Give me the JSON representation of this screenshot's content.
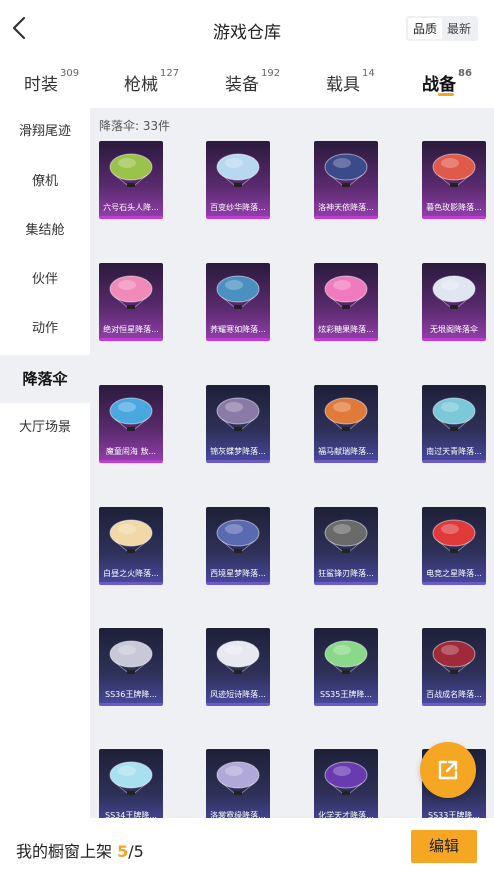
{
  "header": {
    "title": "游戏仓库",
    "sort_options": [
      "品质",
      "最新"
    ],
    "sort_selected": "品质"
  },
  "tabs": [
    {
      "label": "时装",
      "count": "309",
      "active": false
    },
    {
      "label": "枪械",
      "count": "127",
      "active": false
    },
    {
      "label": "装备",
      "count": "192",
      "active": false
    },
    {
      "label": "载具",
      "count": "14",
      "active": false
    },
    {
      "label": "战备",
      "count": "86",
      "active": true
    }
  ],
  "sidebar": {
    "items": [
      {
        "label": "滑翔尾迹",
        "active": false
      },
      {
        "label": "僚机",
        "active": false
      },
      {
        "label": "集结舱",
        "active": false
      },
      {
        "label": "伙伴",
        "active": false
      },
      {
        "label": "动作",
        "active": false
      },
      {
        "label": "降落伞",
        "active": true
      },
      {
        "label": "大厅场景",
        "active": false
      }
    ]
  },
  "content": {
    "count_label": "降落伞: 33件",
    "items": [
      {
        "name": "六号石头人降...",
        "rarity": "purple",
        "color": "#9bc24a"
      },
      {
        "name": "百变纱华降落...",
        "rarity": "purple",
        "color": "#b8d8f0"
      },
      {
        "name": "洛神天依降落...",
        "rarity": "purple",
        "color": "#3b4a8a"
      },
      {
        "name": "暮色玫影降落...",
        "rarity": "purple",
        "color": "#e05a4a"
      },
      {
        "name": "绝对恒星降落...",
        "rarity": "purple",
        "color": "#f08ab8"
      },
      {
        "name": "荞耀寒如降落...",
        "rarity": "purple",
        "color": "#4a90c0"
      },
      {
        "name": "炫彩糖果降落...",
        "rarity": "purple",
        "color": "#f07ac0"
      },
      {
        "name": "无垠阁降落伞",
        "rarity": "purple",
        "color": "#dfe6f2"
      },
      {
        "name": "魔童闹海 敖...",
        "rarity": "purple",
        "color": "#4aa8e0"
      },
      {
        "name": "锦灰蝶梦降落...",
        "rarity": "blue",
        "color": "#8a7aa8"
      },
      {
        "name": "福马献瑞降落...",
        "rarity": "blue",
        "color": "#e07a3a"
      },
      {
        "name": "南过天青降落...",
        "rarity": "blue",
        "color": "#7ac8d8"
      },
      {
        "name": "白昼之火降落...",
        "rarity": "blue",
        "color": "#f0d8a8"
      },
      {
        "name": "西境星梦降落...",
        "rarity": "blue",
        "color": "#5a6ab0"
      },
      {
        "name": "狂鲨锋刃降落...",
        "rarity": "blue",
        "color": "#6a6a6a"
      },
      {
        "name": "电竞之星降落...",
        "rarity": "blue",
        "color": "#e03a3a"
      },
      {
        "name": "SS36王牌降...",
        "rarity": "blue",
        "color": "#c8c8d8"
      },
      {
        "name": "风迹短诗降落...",
        "rarity": "blue",
        "color": "#e8e8f0"
      },
      {
        "name": "SS35王牌降...",
        "rarity": "blue",
        "color": "#8ad88a"
      },
      {
        "name": "百战成名降落...",
        "rarity": "blue",
        "color": "#a02a3a"
      },
      {
        "name": "SS34王牌降...",
        "rarity": "blue",
        "color": "#a8e0f0"
      },
      {
        "name": "洛裳霓缘降落...",
        "rarity": "blue",
        "color": "#b0a8d8"
      },
      {
        "name": "化学天才降落...",
        "rarity": "blue",
        "color": "#6a3ab0"
      },
      {
        "name": "SS33王牌降...",
        "rarity": "blue",
        "color": "#e8e8e8"
      }
    ]
  },
  "fab": {
    "icon": "share-external-icon"
  },
  "bottom": {
    "label": "我的橱窗上架 ",
    "current": "5",
    "total": "/5",
    "edit_label": "编辑"
  },
  "colors": {
    "accent": "#f5a623",
    "purple_rarity": "#c03bd8",
    "blue_rarity": "#6a5acd",
    "content_bg": "#eef0f3"
  }
}
